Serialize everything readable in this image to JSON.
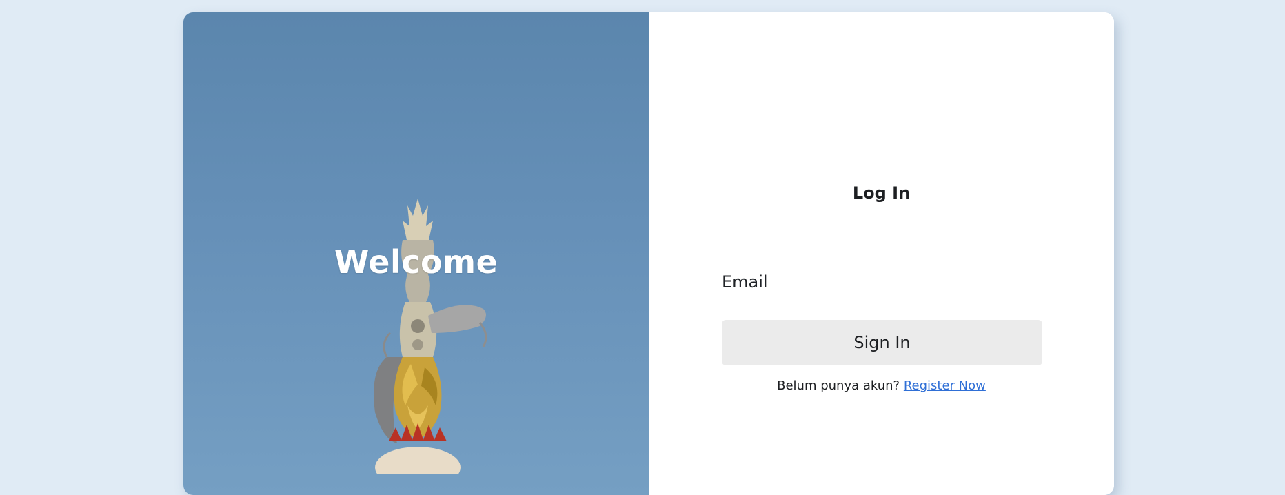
{
  "hero": {
    "title": "Welcome"
  },
  "login": {
    "title": "Log In",
    "email_placeholder": "Email",
    "email_value": "",
    "signin_label": "Sign In",
    "register_prompt": "Belum punya akun?",
    "register_link": "Register Now"
  },
  "colors": {
    "page_background": "#e0ebf5",
    "card_background": "#ffffff",
    "sky": "#6690b8",
    "button_background": "#ebebeb",
    "link": "#2f6fd6"
  }
}
